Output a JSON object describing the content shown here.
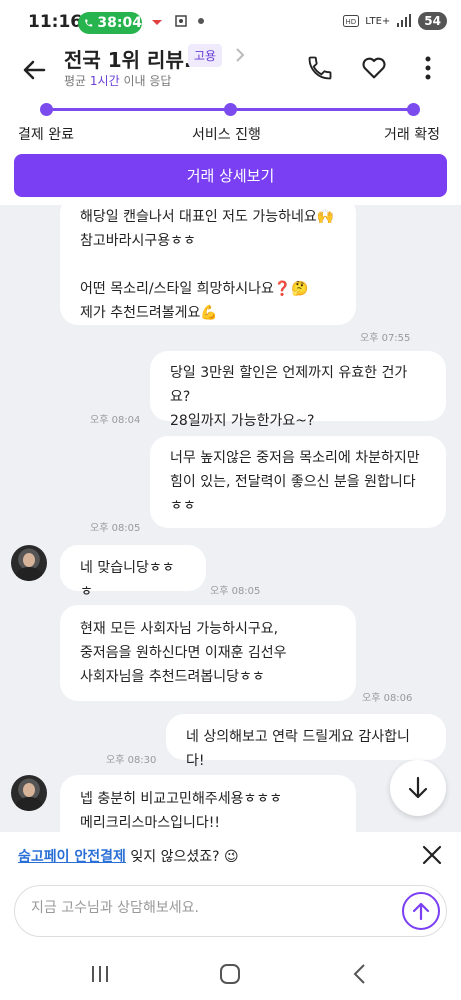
{
  "status_bar": {
    "time": "11:16",
    "call_timer": "38:04",
    "network": "LTE+",
    "battery": "54"
  },
  "header": {
    "title": "전국 1위 리뷰...",
    "tag": "고용",
    "subtitle_prefix": "평균 ",
    "subtitle_highlight": "1시간",
    "subtitle_suffix": " 이내 응답",
    "icons": [
      "back-arrow-icon",
      "phone-icon",
      "heart-icon",
      "more-vertical-icon"
    ]
  },
  "progress": {
    "steps": [
      "결제 완료",
      "서비스 진행",
      "거래 확정"
    ]
  },
  "detail_button": "거래 상세보기",
  "messages": [
    {
      "side": "left",
      "text": "해당일 캔슬나서 대표인 저도 가능하네요🙌\n참고바라시구용ㅎㅎ\n\n어떤 목소리/스타일 희망하시나요❓🤔\n제가 추천드려볼게요💪",
      "time": "오후 07:55"
    },
    {
      "side": "right",
      "text": "당일 3만원 할인은 언제까지 유효한 건가요?\n28일까지 가능한가요~?",
      "time": "오후 08:04"
    },
    {
      "side": "right",
      "text": "너무 높지않은 중저음 목소리에 차분하지만\n힘이 있는, 전달력이 좋으신 분을 원합니다\nㅎㅎ",
      "time": "오후 08:05"
    },
    {
      "side": "left",
      "text": "네 맞습니당ㅎㅎㅎ",
      "time": "오후 08:05"
    },
    {
      "side": "left",
      "text": "현재 모든 사회자님 가능하시구요,\n중저음을 원하신다면 이재훈 김선우\n사회자님을 추천드려봅니당ㅎㅎ",
      "time": "오후 08:06"
    },
    {
      "side": "right",
      "text": "네 상의해보고 연락 드릴게요 감사합니다!",
      "time": "오후 08:30"
    },
    {
      "side": "left",
      "text": "넵 충분히 비교고민해주세용ㅎㅎㅎ\n메리크리스마스입니다!!",
      "time": ""
    }
  ],
  "banner": {
    "link_text": "숨고페이 안전결제",
    "text": " 잊지 않으셨죠? 😉"
  },
  "composer": {
    "placeholder": "지금 고수님과 상담해보세요."
  },
  "colors": {
    "accent": "#7a3ff2",
    "chat_bg": "#eef0f4",
    "call_green": "#27b34e",
    "link_blue": "#2a6fd6"
  }
}
